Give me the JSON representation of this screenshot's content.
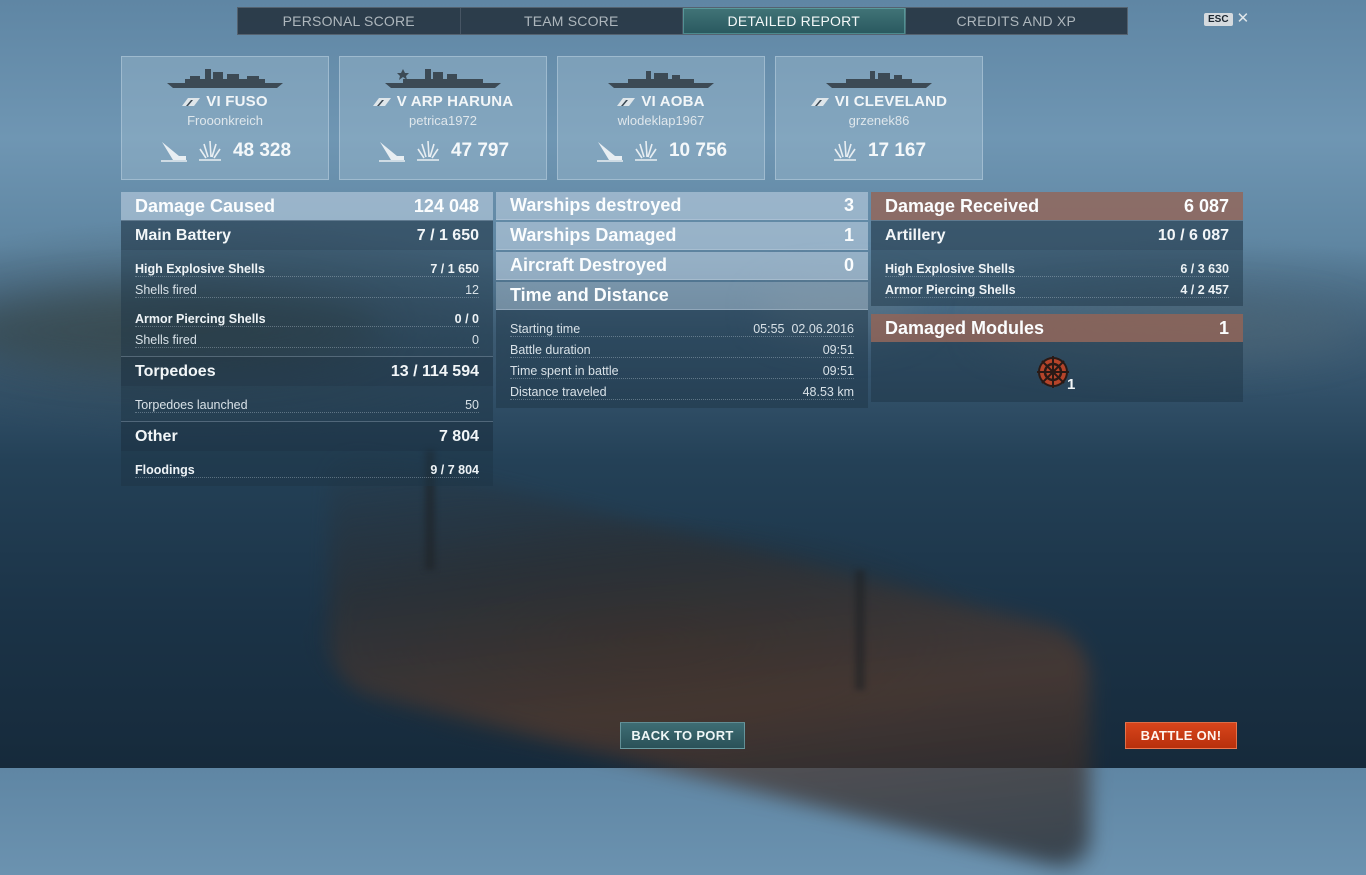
{
  "tabs": [
    {
      "label": "PERSONAL SCORE",
      "active": false
    },
    {
      "label": "TEAM SCORE",
      "active": false
    },
    {
      "label": "DETAILED REPORT",
      "active": true
    },
    {
      "label": "CREDITS AND XP",
      "active": false
    }
  ],
  "esc": {
    "key_label": "ESC"
  },
  "ships": [
    {
      "tier": "VI",
      "name": "FUSO",
      "player": "Frooonkreich",
      "damage": "48 328",
      "sunk": true,
      "icon": "battleship-silhouette"
    },
    {
      "tier": "V",
      "name": "ARP HARUNA",
      "player": "petrica1972",
      "damage": "47 797",
      "sunk": true,
      "icon": "battleship-silhouette"
    },
    {
      "tier": "VI",
      "name": "AOBA",
      "player": "wlodeklap1967",
      "damage": "10 756",
      "sunk": true,
      "icon": "cruiser-silhouette"
    },
    {
      "tier": "VI",
      "name": "CLEVELAND",
      "player": "grzenek86",
      "damage": "17 167",
      "sunk": false,
      "icon": "cruiser-silhouette"
    }
  ],
  "left": {
    "damage_caused": {
      "label": "Damage Caused",
      "value": "124 048"
    },
    "main_battery": {
      "label": "Main Battery",
      "value": "7 / 1 650"
    },
    "he_shells": {
      "label": "High Explosive Shells",
      "value": "7 / 1 650"
    },
    "he_fired": {
      "label": "Shells fired",
      "value": "12"
    },
    "ap_shells": {
      "label": "Armor Piercing Shells",
      "value": "0 / 0"
    },
    "ap_fired": {
      "label": "Shells fired",
      "value": "0"
    },
    "torpedoes": {
      "label": "Torpedoes",
      "value": "13 / 114 594"
    },
    "torp_launched": {
      "label": "Torpedoes launched",
      "value": "50"
    },
    "other": {
      "label": "Other",
      "value": "7 804"
    },
    "floodings": {
      "label": "Floodings",
      "value": "9 / 7 804"
    }
  },
  "middle": {
    "destroyed": {
      "label": "Warships destroyed",
      "value": "3"
    },
    "damaged": {
      "label": "Warships Damaged",
      "value": "1"
    },
    "aircraft": {
      "label": "Aircraft Destroyed",
      "value": "0"
    },
    "time_distance": {
      "label": "Time and Distance"
    },
    "starting_time": {
      "label": "Starting time",
      "time": "05:55",
      "date": "02.06.2016"
    },
    "duration": {
      "label": "Battle duration",
      "value": "09:51"
    },
    "time_spent": {
      "label": "Time spent in battle",
      "value": "09:51"
    },
    "distance": {
      "label": "Distance traveled",
      "value": "48.53 km"
    }
  },
  "right": {
    "damage_received": {
      "label": "Damage Received",
      "value": "6 087"
    },
    "artillery": {
      "label": "Artillery",
      "value": "10 / 6 087"
    },
    "he_shells": {
      "label": "High Explosive Shells",
      "value": "6 / 3 630"
    },
    "ap_shells": {
      "label": "Armor Piercing Shells",
      "value": "4 / 2 457"
    },
    "damaged_modules": {
      "label": "Damaged Modules",
      "value": "1"
    },
    "module_count": "1"
  },
  "buttons": {
    "back": "BACK TO PORT",
    "battle": "BATTLE ON!"
  },
  "colors": {
    "accent_teal": "#2f6168",
    "battle_orange": "#c8380f",
    "received_header": "#8a5f52"
  }
}
